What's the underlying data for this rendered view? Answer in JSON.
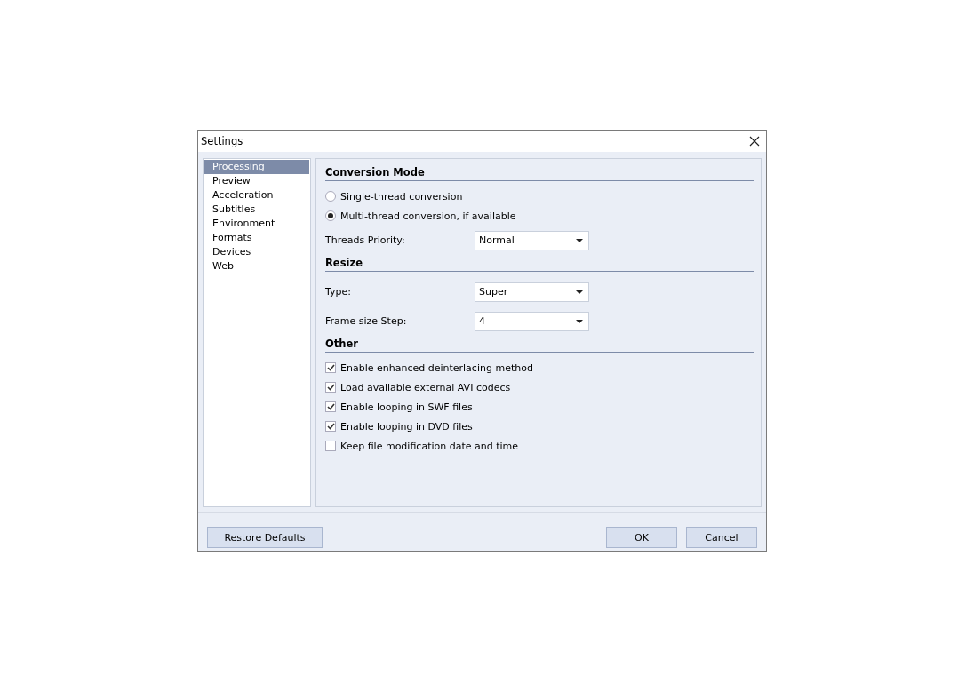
{
  "window": {
    "title": "Settings"
  },
  "sidebar": {
    "items": [
      {
        "label": "Processing",
        "selected": true
      },
      {
        "label": "Preview",
        "selected": false
      },
      {
        "label": "Acceleration",
        "selected": false
      },
      {
        "label": "Subtitles",
        "selected": false
      },
      {
        "label": "Environment",
        "selected": false
      },
      {
        "label": "Formats",
        "selected": false
      },
      {
        "label": "Devices",
        "selected": false
      },
      {
        "label": "Web",
        "selected": false
      }
    ]
  },
  "sections": [
    {
      "title": "Conversion Mode",
      "items": [
        {
          "kind": "radio",
          "label": "Single-thread conversion",
          "selected": false
        },
        {
          "kind": "radio",
          "label": "Multi-thread conversion, if available",
          "selected": true
        },
        {
          "kind": "select",
          "label": "Threads Priority:",
          "value": "Normal"
        }
      ]
    },
    {
      "title": "Resize",
      "items": [
        {
          "kind": "select",
          "label": "Type:",
          "value": "Super"
        },
        {
          "kind": "select",
          "label": "Frame size Step:",
          "value": "4"
        }
      ]
    },
    {
      "title": "Other",
      "items": [
        {
          "kind": "checkbox",
          "label": "Enable enhanced deinterlacing method",
          "checked": true
        },
        {
          "kind": "checkbox",
          "label": "Load available external AVI codecs",
          "checked": true
        },
        {
          "kind": "checkbox",
          "label": "Enable looping in SWF files",
          "checked": true
        },
        {
          "kind": "checkbox",
          "label": "Enable looping in DVD files",
          "checked": true
        },
        {
          "kind": "checkbox",
          "label": "Keep file modification date and time",
          "checked": false
        }
      ]
    }
  ],
  "footer": {
    "left_buttons": [
      "Restore Defaults"
    ],
    "right_buttons": [
      "OK",
      "Cancel"
    ]
  }
}
